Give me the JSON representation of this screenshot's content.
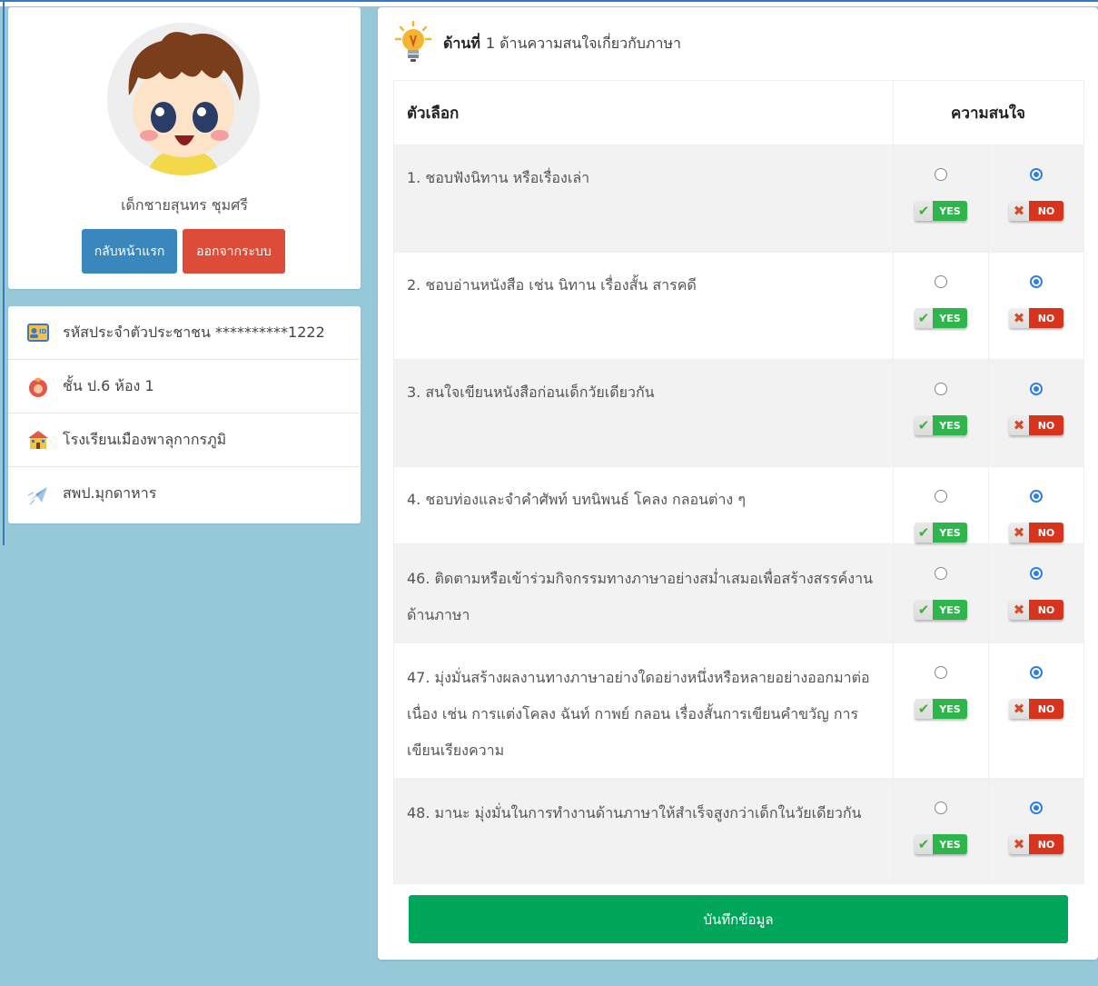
{
  "profile": {
    "name": "เด็กชายสุนทร ชุมศรี",
    "home_button": "กลับหน้าแรก",
    "logout_button": "ออกจากระบบ"
  },
  "info": [
    {
      "icon": "id-card-icon",
      "label": "รหัสประจำตัวประชาชน **********1222"
    },
    {
      "icon": "class-icon",
      "label": "ชั้น ป.6 ห้อง 1"
    },
    {
      "icon": "school-icon",
      "label": "โรงเรียนเมืองพาลุกากรภูมิ"
    },
    {
      "icon": "plane-icon",
      "label": "สพป.มุกดาหาร"
    }
  ],
  "section": {
    "prefix": "ด้านที่",
    "title": "1 ด้านความสนใจเกี่ยวกับภาษา"
  },
  "table": {
    "col_option": "ตัวเลือก",
    "col_interest": "ความสนใจ",
    "yes_label": "YES",
    "no_label": "NO",
    "rows": [
      {
        "text": "1. ชอบฟังนิทาน หรือเรื่องเล่า",
        "selected": "no"
      },
      {
        "text": "2. ชอบอ่านหนังสือ เช่น นิทาน เรื่องสั้น สารคดี",
        "selected": "no"
      },
      {
        "text": "3. สนใจเขียนหนังสือก่อนเด็กวัยเดียวกัน",
        "selected": "no"
      },
      {
        "text": "4. ชอบท่องและจำคำศัพท์ บทนิพนธ์ โคลง กลอนต่าง ๆ",
        "selected": "no"
      },
      {
        "text": "46. ติดตามหรือเข้าร่วมกิจกรรมทางภาษาอย่างสม่ำเสมอเพื่อสร้างสรรค์งานด้านภาษา",
        "selected": "no"
      },
      {
        "text": "47. มุ่งมั่นสร้างผลงานทางภาษาอย่างใดอย่างหนึ่งหรือหลายอย่างออกมาต่อเนื่อง เช่น การแต่งโคลง ฉันท์ กาพย์ กลอน เรื่องสั้นการเขียนคำขวัญ การเขียนเรียงความ",
        "selected": "no"
      },
      {
        "text": "48. มานะ มุ่งมั่นในการทำงานด้านภาษาให้สำเร็จสูงกว่าเด็กในวัยเดียวกัน",
        "selected": "no"
      }
    ]
  },
  "save_button": "บันทึกข้อมูล",
  "colors": {
    "background": "#96c9d8",
    "primary": "#3a87be",
    "danger": "#dd4b39",
    "success": "#00a65a",
    "radio": "#2e7ee6"
  }
}
